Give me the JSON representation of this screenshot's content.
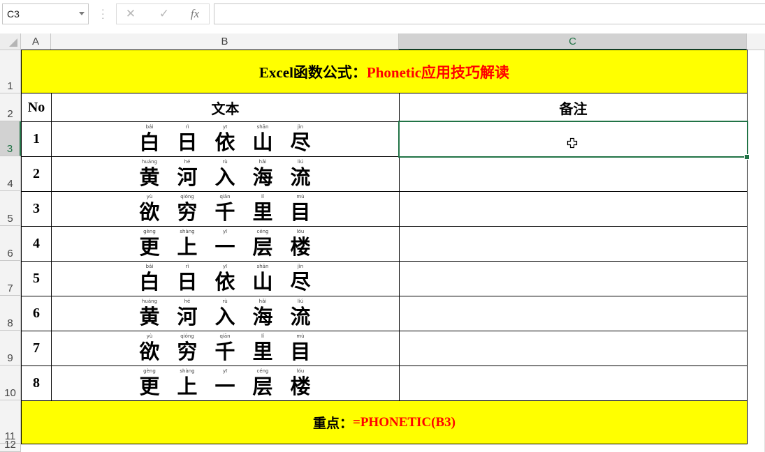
{
  "name_box": {
    "value": "C3"
  },
  "formula_bar": {
    "cancel_icon": "✕",
    "enter_icon": "✓",
    "fx_label": "fx",
    "formula": ""
  },
  "columns": [
    "A",
    "B",
    "C"
  ],
  "rows": [
    "1",
    "2",
    "3",
    "4",
    "5",
    "6",
    "7",
    "8",
    "9",
    "10",
    "11",
    "12"
  ],
  "selected_cell": "C3",
  "title": {
    "black": "Excel函数公式：",
    "red": "Phonetic应用技巧解读"
  },
  "headers": {
    "no": "No",
    "text": "文本",
    "note": "备注"
  },
  "data_rows": [
    {
      "no": "1",
      "chars": [
        [
          "白",
          "bái"
        ],
        [
          "日",
          "rì"
        ],
        [
          "依",
          "yī"
        ],
        [
          "山",
          "shān"
        ],
        [
          "尽",
          "jìn"
        ]
      ],
      "note": ""
    },
    {
      "no": "2",
      "chars": [
        [
          "黄",
          "huáng"
        ],
        [
          "河",
          "hé"
        ],
        [
          "入",
          "rù"
        ],
        [
          "海",
          "hǎi"
        ],
        [
          "流",
          "liú"
        ]
      ],
      "note": ""
    },
    {
      "no": "3",
      "chars": [
        [
          "欲",
          "yù"
        ],
        [
          "穷",
          "qióng"
        ],
        [
          "千",
          "qiān"
        ],
        [
          "里",
          "lǐ"
        ],
        [
          "目",
          "mù"
        ]
      ],
      "note": ""
    },
    {
      "no": "4",
      "chars": [
        [
          "更",
          "gèng"
        ],
        [
          "上",
          "shàng"
        ],
        [
          "一",
          "yī"
        ],
        [
          "层",
          "céng"
        ],
        [
          "楼",
          "lóu"
        ]
      ],
      "note": ""
    },
    {
      "no": "5",
      "chars": [
        [
          "白",
          "bái"
        ],
        [
          "日",
          "rì"
        ],
        [
          "依",
          "yī"
        ],
        [
          "山",
          "shān"
        ],
        [
          "尽",
          "jìn"
        ]
      ],
      "note": ""
    },
    {
      "no": "6",
      "chars": [
        [
          "黄",
          "huáng"
        ],
        [
          "河",
          "hé"
        ],
        [
          "入",
          "rù"
        ],
        [
          "海",
          "hǎi"
        ],
        [
          "流",
          "liú"
        ]
      ],
      "note": ""
    },
    {
      "no": "7",
      "chars": [
        [
          "欲",
          "yù"
        ],
        [
          "穷",
          "qióng"
        ],
        [
          "千",
          "qiān"
        ],
        [
          "里",
          "lǐ"
        ],
        [
          "目",
          "mù"
        ]
      ],
      "note": ""
    },
    {
      "no": "8",
      "chars": [
        [
          "更",
          "gèng"
        ],
        [
          "上",
          "shàng"
        ],
        [
          "一",
          "yī"
        ],
        [
          "层",
          "céng"
        ],
        [
          "楼",
          "lóu"
        ]
      ],
      "note": ""
    }
  ],
  "footer": {
    "black": "重点：",
    "red": "=PHONETIC(B3)"
  },
  "colors": {
    "highlight": "#ffff00",
    "accent_red": "#ff0000",
    "selection_green": "#217346"
  },
  "icons": {
    "cursor": "cell-select-cross-icon"
  }
}
